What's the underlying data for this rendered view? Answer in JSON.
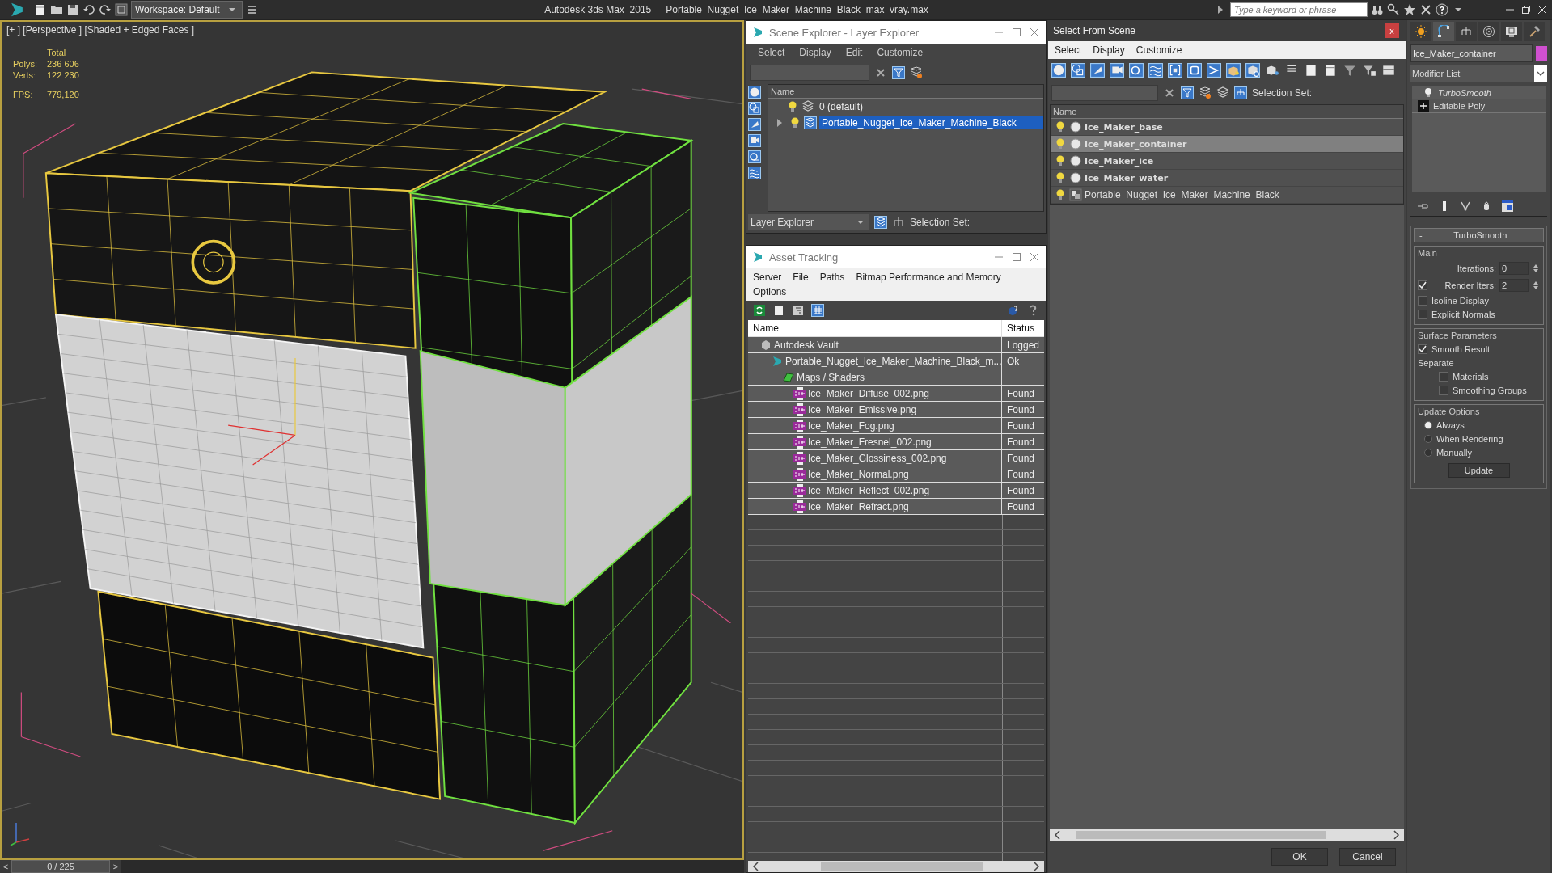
{
  "title_bar": {
    "workspace": "Workspace: Default",
    "app": "Autodesk 3ds Max  2015",
    "file": "Portable_Nugget_Ice_Maker_Machine_Black_max_vray.max",
    "search": {
      "placeholder": "Type a keyword or phrase"
    }
  },
  "viewport": {
    "label": "[+ ] [Perspective ] [Shaded + Edged Faces ]",
    "stats_header": "Total",
    "stats": [
      {
        "label": "Polys:",
        "value": "236 606"
      },
      {
        "label": "Verts:",
        "value": "122 230"
      }
    ],
    "fps": {
      "label": "FPS:",
      "value": "779,120"
    },
    "timeline": {
      "prev": "<",
      "frame": "0 / 225",
      "next": ">"
    }
  },
  "scene_explorer": {
    "title": "Scene Explorer - Layer Explorer",
    "menu": [
      "Select",
      "Display",
      "Edit",
      "Customize"
    ],
    "column": "Name",
    "layers": [
      {
        "name": "0 (default)",
        "expandable": false,
        "selected": false
      },
      {
        "name": "Portable_Nugget_Ice_Maker_Machine_Black",
        "expandable": true,
        "selected": true
      }
    ],
    "mode": "Layer Explorer",
    "selection_set": "Selection Set:"
  },
  "asset_tracking": {
    "title": "Asset Tracking",
    "menu": [
      "Server",
      "File",
      "Paths",
      "Bitmap Performance and Memory",
      "Options"
    ],
    "columns": [
      "Name",
      "Status"
    ],
    "rows": [
      {
        "name": "Autodesk Vault",
        "status": "Logged",
        "kind": "vault",
        "children": [
          {
            "name": "Portable_Nugget_Ice_Maker_Machine_Black_m...",
            "status": "Ok",
            "kind": "scene",
            "children": [
              {
                "name": "Maps / Shaders",
                "kind": "folder",
                "children": [
                  {
                    "name": "Ice_Maker_Diffuse_002.png",
                    "status": "Found",
                    "kind": "png"
                  },
                  {
                    "name": "Ice_Maker_Emissive.png",
                    "status": "Found",
                    "kind": "png"
                  },
                  {
                    "name": "Ice_Maker_Fog.png",
                    "status": "Found",
                    "kind": "png"
                  },
                  {
                    "name": "Ice_Maker_Fresnel_002.png",
                    "status": "Found",
                    "kind": "png"
                  },
                  {
                    "name": "Ice_Maker_Glossiness_002.png",
                    "status": "Found",
                    "kind": "png"
                  },
                  {
                    "name": "Ice_Maker_Normal.png",
                    "status": "Found",
                    "kind": "png"
                  },
                  {
                    "name": "Ice_Maker_Reflect_002.png",
                    "status": "Found",
                    "kind": "png"
                  },
                  {
                    "name": "Ice_Maker_Refract.png",
                    "status": "Found",
                    "kind": "png"
                  }
                ]
              }
            ]
          }
        ]
      }
    ]
  },
  "select_from_scene": {
    "title": "Select From Scene",
    "close": "x",
    "menu": [
      "Select",
      "Display",
      "Customize"
    ],
    "selection_set": "Selection Set:",
    "column": "Name",
    "objects": [
      {
        "name": "Ice_Maker_base",
        "kind": "geometry",
        "selected": false
      },
      {
        "name": "Ice_Maker_container",
        "kind": "geometry",
        "selected": true
      },
      {
        "name": "Ice_Maker_ice",
        "kind": "geometry",
        "selected": false
      },
      {
        "name": "Ice_Maker_water",
        "kind": "geometry",
        "selected": false
      },
      {
        "name": "Portable_Nugget_Ice_Maker_Machine_Black",
        "kind": "group",
        "selected": false
      }
    ],
    "buttons": [
      "OK",
      "Cancel"
    ]
  },
  "command_panel": {
    "object_name": "Ice_Maker_container",
    "modifier_list": "Modifier List",
    "stack": [
      {
        "name": "TurboSmooth",
        "kind": "modifier"
      },
      {
        "name": "Editable Poly",
        "kind": "base"
      }
    ],
    "rollout": {
      "collapse": "-",
      "title": "TurboSmooth",
      "main": {
        "legend": "Main",
        "iterations": {
          "label": "Iterations:",
          "value": "0"
        },
        "render_iters": {
          "label": "Render Iters:",
          "value": "2",
          "checked": true
        },
        "options": [
          {
            "label": "Isoline Display",
            "checked": false
          },
          {
            "label": "Explicit Normals",
            "checked": false
          }
        ]
      },
      "surface": {
        "legend": "Surface Parameters",
        "smooth_result": {
          "label": "Smooth Result",
          "checked": true
        },
        "separate": "Separate",
        "options": [
          {
            "label": "Materials",
            "checked": false
          },
          {
            "label": "Smoothing Groups",
            "checked": false
          }
        ]
      },
      "update": {
        "legend": "Update Options",
        "radios": [
          {
            "label": "Always",
            "selected": true
          },
          {
            "label": "When Rendering",
            "selected": false
          },
          {
            "label": "Manually",
            "selected": false
          }
        ],
        "button": "Update"
      }
    }
  }
}
